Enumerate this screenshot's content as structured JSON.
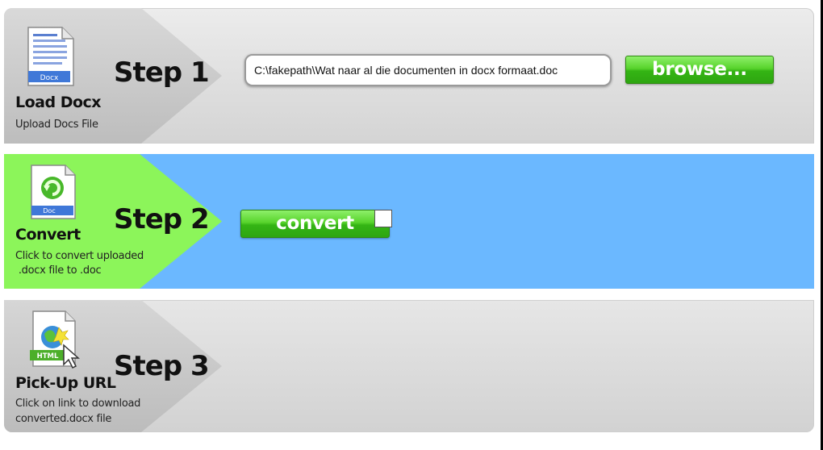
{
  "step1": {
    "step_label": "Step 1",
    "title": "Load Docx",
    "desc_line1": "Upload Docs File",
    "icon_label": "Docx",
    "file_value": "C:\\fakepath\\Wat naar al die documenten in docx formaat.doc",
    "browse_label": "browse..."
  },
  "step2": {
    "step_label": "Step 2",
    "title": "Convert",
    "desc_line1": "Click to convert uploaded",
    "desc_line2": " .docx file to .doc",
    "icon_label": "Doc",
    "convert_label": "convert"
  },
  "step3": {
    "step_label": "Step 3",
    "title": "Pick-Up URL",
    "desc_line1": "Click on link to download",
    "desc_line2": "converted.docx file",
    "icon_label": "HTML"
  },
  "colors": {
    "step2_background": "#6bb8ff",
    "step2_arrow": "#8cf55a",
    "button_green": "#3cbf18"
  }
}
